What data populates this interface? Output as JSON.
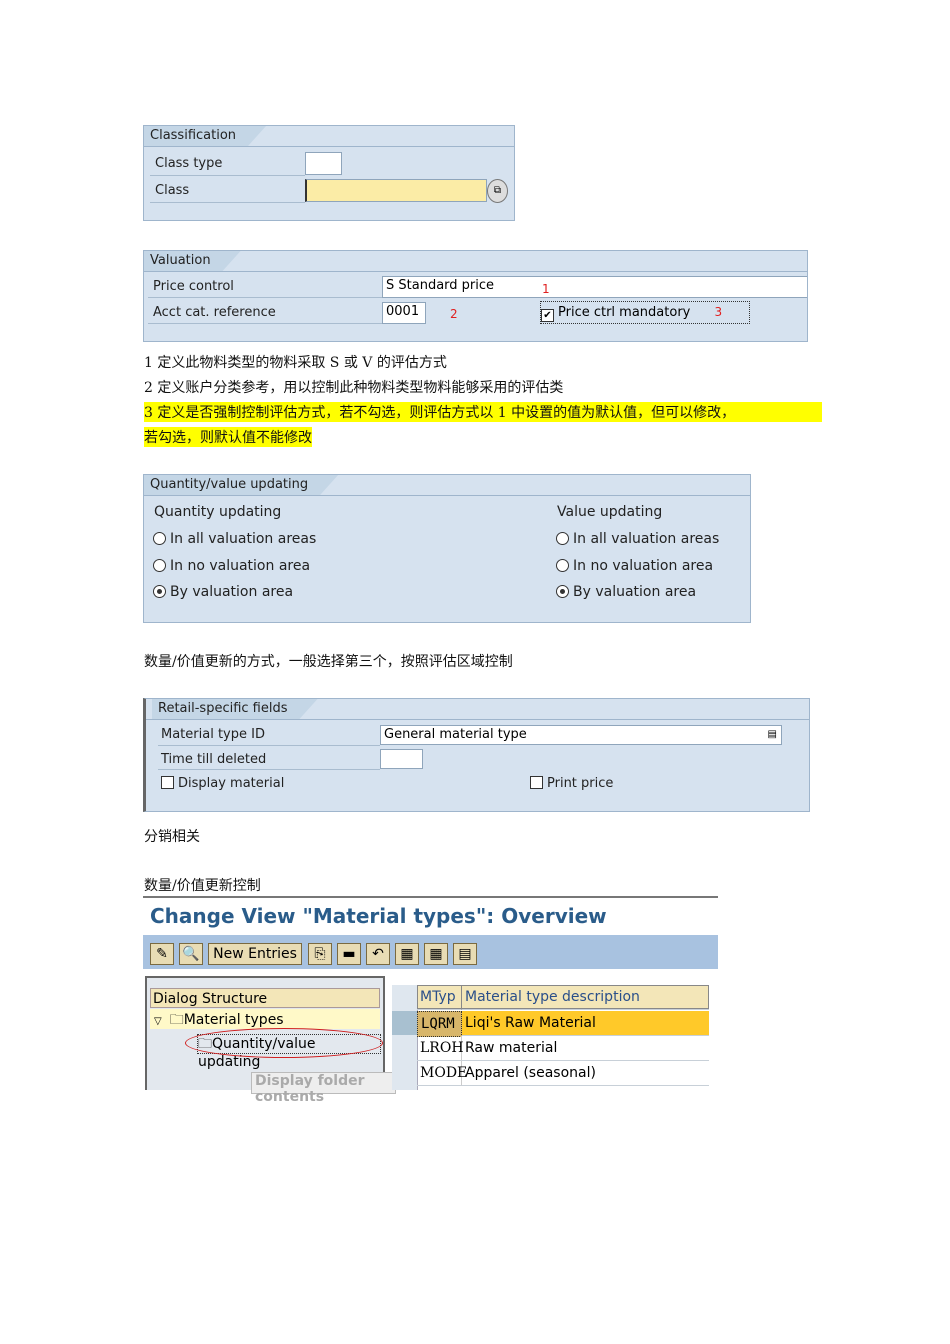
{
  "classification": {
    "title": "Classification",
    "class_type_label": "Class type",
    "class_type_value": "",
    "class_label": "Class",
    "class_value": ""
  },
  "valuation": {
    "title": "Valuation",
    "price_control_label": "Price control",
    "price_control_value": "S Standard price",
    "acct_cat_label": "Acct cat. reference",
    "acct_cat_value": "0001",
    "price_ctrl_mandatory_label": "Price ctrl mandatory",
    "price_ctrl_mandatory_checked": true,
    "markers": [
      "1",
      "2",
      "3"
    ]
  },
  "notes1": [
    "1 定义此物料类型的物料采取 S 或 V 的评估方式",
    "2 定义账户分类参考，用以控制此种物料类型物料能够采用的评估类",
    "3 定义是否强制控制评估方式，若不勾选，则评估方式以 1 中设置的值为默认值，但可以修改，",
    "若勾选，则默认值不能修改"
  ],
  "qty_value": {
    "title": "Quantity/value updating",
    "qty_heading": "Quantity updating",
    "value_heading": "Value updating",
    "options": [
      "In all valuation areas",
      "In no valuation area",
      "By valuation area"
    ],
    "qty_selected": 2,
    "value_selected": 2
  },
  "note2": "数量/价值更新的方式，一般选择第三个，按照评估区域控制",
  "retail": {
    "title": "Retail-specific fields",
    "material_type_id_label": "Material type ID",
    "material_type_id_value": "General material type",
    "time_till_deleted_label": "Time till deleted",
    "time_till_deleted_value": "",
    "display_material_label": "Display material",
    "print_price_label": "Print price"
  },
  "note3": "分销相关",
  "note4": "数量/价值更新控制",
  "sap": {
    "title": "Change View \"Material types\": Overview",
    "new_entries": "New Entries",
    "dialog_structure": "Dialog Structure",
    "tree": [
      "Material types",
      "Quantity/value updating"
    ],
    "tooltip": "Display folder contents",
    "columns": [
      "MTyp",
      "Material type description"
    ],
    "rows": [
      [
        "LQRM",
        "Liqi's Raw Material"
      ],
      [
        "LROH",
        "Raw material"
      ],
      [
        "MODE",
        "Apparel (seasonal)"
      ]
    ]
  }
}
